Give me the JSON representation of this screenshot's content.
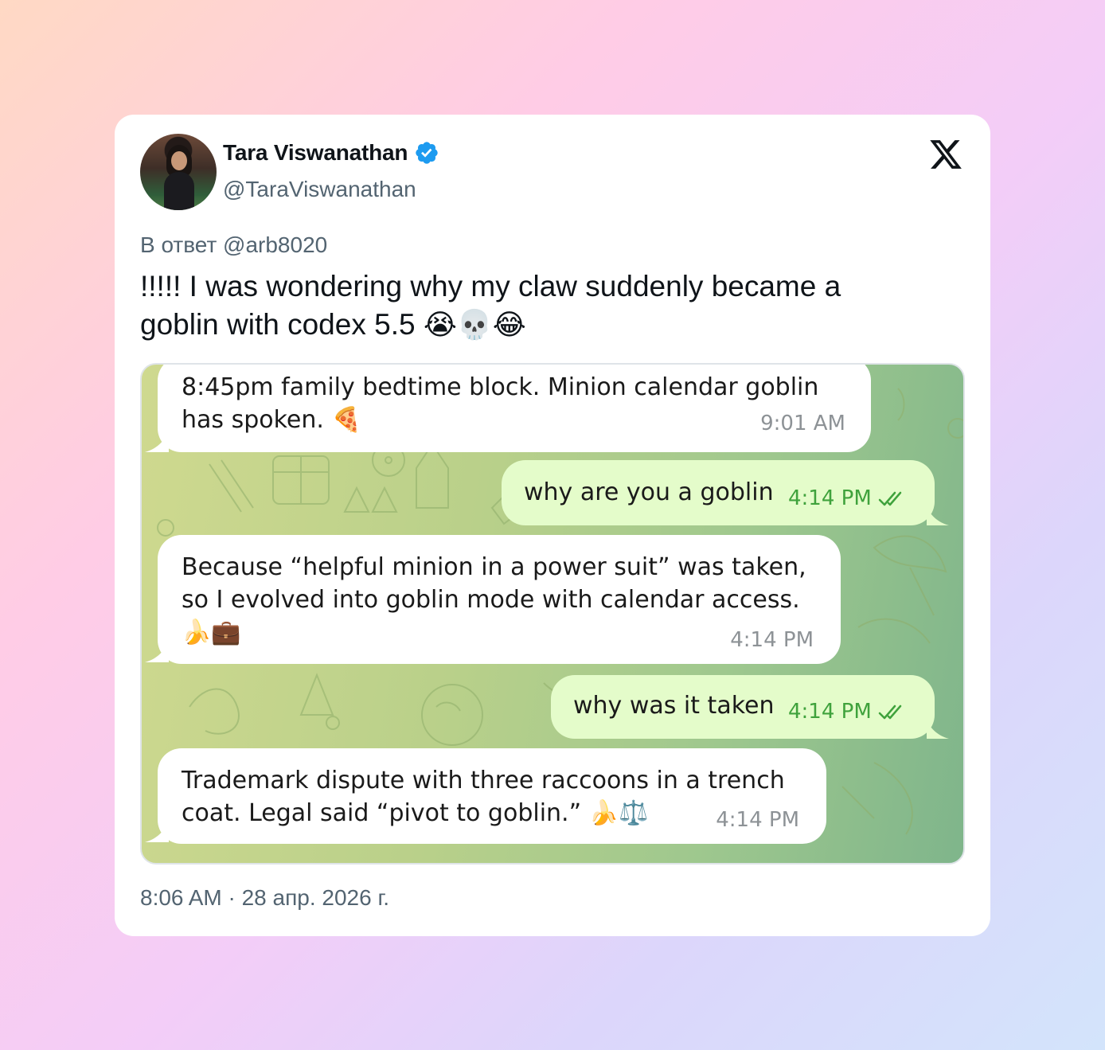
{
  "author": {
    "name": "Tara Viswanathan",
    "handle": "@TaraViswanathan",
    "verified": true
  },
  "reply_to": "В ответ @arb8020",
  "tweet": {
    "line1": "!!!!! I was wondering why my claw suddenly became a",
    "line2_text": "goblin with codex 5.5 ",
    "line2_emoji": "😭💀😂"
  },
  "chat": {
    "msg1": {
      "line1": "8:45pm family bedtime block. Minion calendar goblin",
      "line2": "has spoken. 🍕",
      "time": "9:01 AM"
    },
    "msg2": {
      "text": "why are you a goblin",
      "time": "4:14 PM"
    },
    "msg3": {
      "line1": "Because “helpful minion in a power suit” was taken,",
      "line2": "so I evolved into goblin mode with calendar access.",
      "line3": "🍌💼",
      "time": "4:14 PM"
    },
    "msg4": {
      "text": "why was it taken",
      "time": "4:14 PM"
    },
    "msg5": {
      "line1": "Trademark dispute with three raccoons in a trench",
      "line2": "coat. Legal said “pivot to goblin.” 🍌⚖️",
      "time": "4:14 PM"
    }
  },
  "timestamp": "8:06 AM · 28 апр. 2026 г.",
  "colors": {
    "verified": "#1d9bf0",
    "outgoing_bubble": "#e4fcca",
    "outgoing_time": "#3fa23c"
  },
  "icons": [
    "verified-badge-icon",
    "x-logo-icon",
    "double-check-icon"
  ]
}
